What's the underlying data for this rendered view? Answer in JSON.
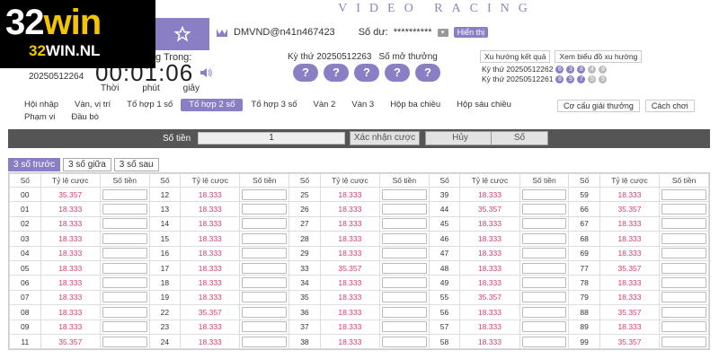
{
  "logo": {
    "main_a": "32",
    "main_b": "win",
    "sub_a": "32",
    "sub_b": "WIN.NL"
  },
  "header": {
    "banner": "VIDEO RACING",
    "user": "DMVND@n41n467423",
    "balance_label": "Số dư:",
    "balance_value": "**********",
    "show_button": "Hiển thị"
  },
  "countdown": {
    "label": "g Trong:",
    "draw_id": "20250512264",
    "time": "00:01:06",
    "units": [
      "Thời",
      "phút",
      "giây"
    ]
  },
  "next_draw": {
    "label": "Kỳ thứ 20250512263",
    "open_label": "Số mở thưởng",
    "balls": [
      "?",
      "?",
      "?",
      "?",
      "?"
    ]
  },
  "trends": {
    "result_trend": "Xu hướng kết quả",
    "chart_trend": "Xem biểu đồ xu hướng"
  },
  "results": [
    {
      "label": "Kỳ thứ 20250512262",
      "balls": [
        {
          "v": "6",
          "c": "p"
        },
        {
          "v": "3",
          "c": "p"
        },
        {
          "v": "8",
          "c": "p"
        },
        {
          "v": "4",
          "c": "g"
        },
        {
          "v": "9",
          "c": "g"
        }
      ]
    },
    {
      "label": "Kỳ thứ 20250512261",
      "balls": [
        {
          "v": "8",
          "c": "p"
        },
        {
          "v": "9",
          "c": "p"
        },
        {
          "v": "7",
          "c": "p"
        },
        {
          "v": "5",
          "c": "g"
        },
        {
          "v": "9",
          "c": "g"
        }
      ]
    }
  ],
  "tabs": {
    "row1": [
      {
        "label": "Hội nhập",
        "active": false
      },
      {
        "label": "Vàn, vị trí",
        "active": false
      },
      {
        "label": "Tổ hợp 1 số",
        "active": false
      },
      {
        "label": "Tổ hợp 2 số",
        "active": true
      },
      {
        "label": "Tổ hợp 3 số",
        "active": false
      },
      {
        "label": "Vàn 2",
        "active": false
      },
      {
        "label": "Vàn 3",
        "active": false
      },
      {
        "label": "Hộp ba chiều",
        "active": false
      },
      {
        "label": "Hộp sáu chiều",
        "active": false
      }
    ],
    "row2": [
      {
        "label": "Phạm vi",
        "active": false
      },
      {
        "label": "Đầu bò",
        "active": false
      }
    ],
    "right": [
      "Cơ cấu giải thưởng",
      "Cách chơi"
    ]
  },
  "betbar": {
    "amount_label": "Số tiền",
    "amount_value": "1",
    "confirm": "Xác nhận cược",
    "cancel": "Hủy",
    "number": "Số"
  },
  "subtabs": [
    {
      "label": "3 số trước",
      "active": true
    },
    {
      "label": "3 số giữa",
      "active": false
    },
    {
      "label": "3 số sau",
      "active": false
    }
  ],
  "table": {
    "headers": [
      "Số",
      "Tỷ lệ cược",
      "Số tiền"
    ],
    "columns": [
      [
        [
          "00",
          "35.357"
        ],
        [
          "01",
          "18.333"
        ],
        [
          "02",
          "18.333"
        ],
        [
          "03",
          "18.333"
        ],
        [
          "04",
          "18.333"
        ],
        [
          "05",
          "18.333"
        ],
        [
          "06",
          "18.333"
        ],
        [
          "07",
          "18.333"
        ],
        [
          "08",
          "18.333"
        ],
        [
          "09",
          "18.333"
        ],
        [
          "11",
          "35.357"
        ]
      ],
      [
        [
          "12",
          "18.333"
        ],
        [
          "13",
          "18.333"
        ],
        [
          "14",
          "18.333"
        ],
        [
          "15",
          "18.333"
        ],
        [
          "16",
          "18.333"
        ],
        [
          "17",
          "18.333"
        ],
        [
          "18",
          "18.333"
        ],
        [
          "19",
          "18.333"
        ],
        [
          "22",
          "35.357"
        ],
        [
          "23",
          "18.333"
        ],
        [
          "24",
          "18.333"
        ]
      ],
      [
        [
          "25",
          "18.333"
        ],
        [
          "26",
          "18.333"
        ],
        [
          "27",
          "18.333"
        ],
        [
          "28",
          "18.333"
        ],
        [
          "29",
          "18.333"
        ],
        [
          "33",
          "35.357"
        ],
        [
          "34",
          "18.333"
        ],
        [
          "35",
          "18.333"
        ],
        [
          "36",
          "18.333"
        ],
        [
          "37",
          "18.333"
        ],
        [
          "38",
          "18.333"
        ]
      ],
      [
        [
          "39",
          "18.333"
        ],
        [
          "44",
          "35.357"
        ],
        [
          "45",
          "18.333"
        ],
        [
          "46",
          "18.333"
        ],
        [
          "47",
          "18.333"
        ],
        [
          "48",
          "18.333"
        ],
        [
          "49",
          "18.333"
        ],
        [
          "55",
          "35.357"
        ],
        [
          "56",
          "18.333"
        ],
        [
          "57",
          "18.333"
        ],
        [
          "58",
          "18.333"
        ]
      ],
      [
        [
          "59",
          "18.333"
        ],
        [
          "66",
          "35.357"
        ],
        [
          "67",
          "18.333"
        ],
        [
          "68",
          "18.333"
        ],
        [
          "69",
          "18.333"
        ],
        [
          "77",
          "35.357"
        ],
        [
          "78",
          "18.333"
        ],
        [
          "79",
          "18.333"
        ],
        [
          "88",
          "35.357"
        ],
        [
          "89",
          "18.333"
        ],
        [
          "99",
          "35.357"
        ]
      ]
    ]
  }
}
